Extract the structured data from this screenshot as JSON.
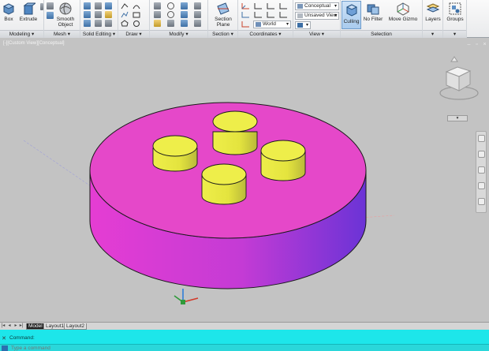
{
  "ribbon": {
    "modeling": {
      "title": "Modeling",
      "box_label": "Box",
      "extrude_label": "Extrude"
    },
    "mesh": {
      "title": "Mesh",
      "smooth_label_1": "Smooth",
      "smooth_label_2": "Object"
    },
    "solid_editing": {
      "title": "Solid Editing"
    },
    "draw": {
      "title": "Draw"
    },
    "modify": {
      "title": "Modify"
    },
    "section": {
      "title": "Section",
      "section_plane_1": "Section",
      "section_plane_2": "Plane"
    },
    "coordinates": {
      "title": "Coordinates",
      "ucs_value": "World"
    },
    "view": {
      "title": "View",
      "visual_style": "Conceptual",
      "named_view": "Unsaved View"
    },
    "selection": {
      "title": "Selection",
      "culling_label": "Culling",
      "no_filter_label": "No Filter",
      "move_gizmo_label": "Move Gizmo"
    },
    "layers": {
      "label": "Layers"
    },
    "groups": {
      "label": "Groups"
    }
  },
  "viewport": {
    "label": "[-][Custom View][Conceptual]"
  },
  "tabs": [
    {
      "label": "Model",
      "active": true
    },
    {
      "label": "Layout1",
      "active": false
    },
    {
      "label": "Layout2",
      "active": false
    }
  ],
  "command": {
    "history": "Command:",
    "placeholder": "Type a command"
  },
  "colors": {
    "disk_top": "#e548c9",
    "disk_side_left": "#e53dd3",
    "disk_side_right": "#6b33d6",
    "cylinder_top": "#eeee4a",
    "cylinder_side": "#d9d93a",
    "command_line": "#1de6ea"
  }
}
